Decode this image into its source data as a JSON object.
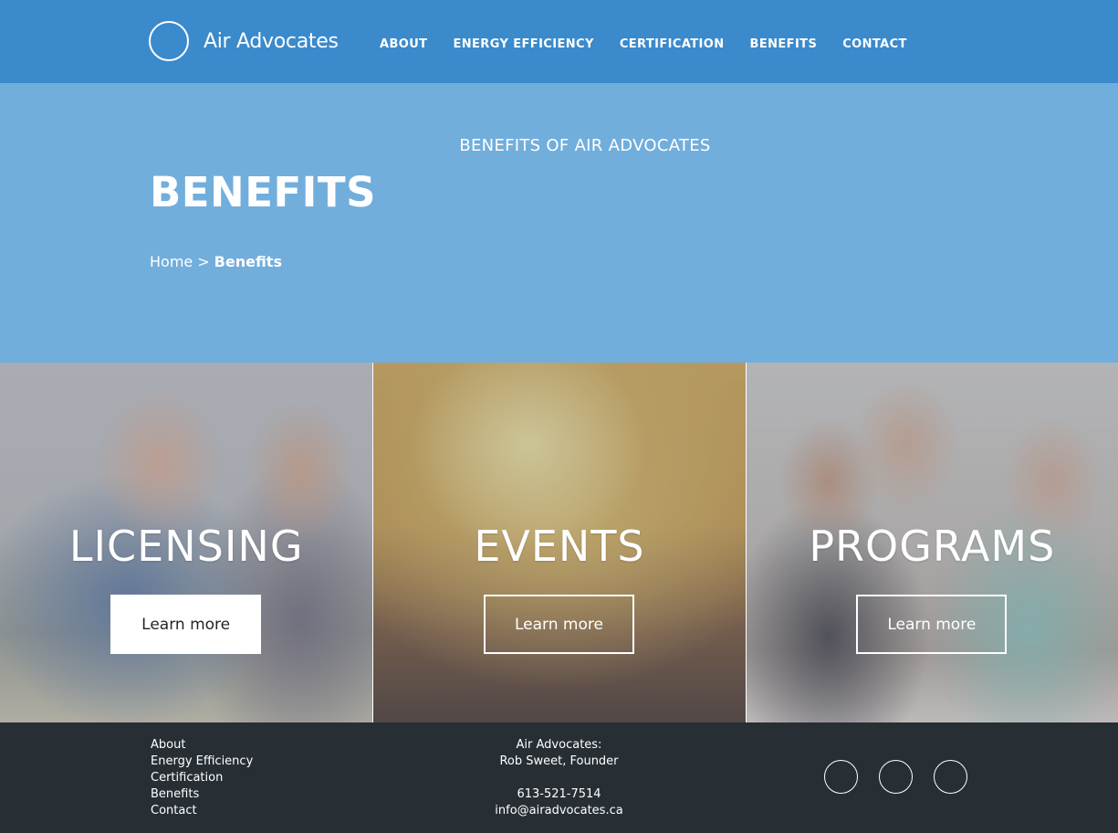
{
  "brand": {
    "name": "Air Advocates"
  },
  "nav": {
    "items": [
      {
        "label": "ABOUT"
      },
      {
        "label": "ENERGY EFFICIENCY"
      },
      {
        "label": "CERTIFICATION"
      },
      {
        "label": "BENEFITS"
      },
      {
        "label": "CONTACT"
      }
    ]
  },
  "hero": {
    "subtitle": "BENEFITS OF AIR ADVOCATES",
    "title": "BENEFITS",
    "breadcrumb": {
      "home": "Home",
      "separator": ">",
      "current": "Benefits"
    }
  },
  "cards": [
    {
      "title": "LICENSING",
      "button": "Learn more",
      "button_style": "solid"
    },
    {
      "title": "EVENTS",
      "button": "Learn more",
      "button_style": "outline"
    },
    {
      "title": "PROGRAMS",
      "button": "Learn more",
      "button_style": "outline"
    }
  ],
  "footer": {
    "links": [
      "About",
      "Energy Efficiency",
      "Certification",
      "Benefits",
      "Contact"
    ],
    "org": "Air Advocates:",
    "founder": "Rob Sweet, Founder",
    "phone": "613-521-7514",
    "email": "info@airadvocates.ca",
    "social_icons": [
      "social-icon-1",
      "social-icon-2",
      "social-icon-3"
    ]
  },
  "colors": {
    "nav_bg": "#3a8acc",
    "hero_bg": "#71aedc",
    "footer_bg": "#272e34",
    "text": "#ffffff"
  }
}
